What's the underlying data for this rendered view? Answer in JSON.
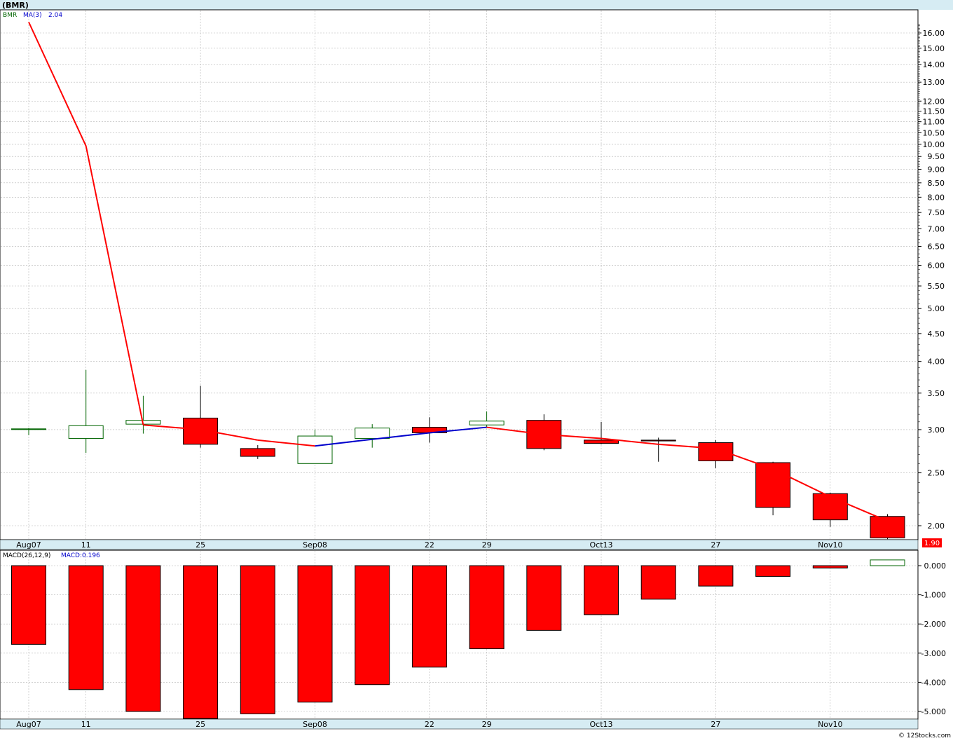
{
  "title": "(BMR)",
  "legend": {
    "symbol": "BMR",
    "ma_label": "MA(3)",
    "ma_value": "2.04"
  },
  "last_price_tag": "1.90",
  "macd_legend": {
    "params": "MACD(26,12,9)",
    "label": "MACD:0.196"
  },
  "watermark": "© 12Stocks.com",
  "x_labels": [
    "Aug07",
    "11",
    "25",
    "Sep08",
    "22",
    "29",
    "Oct13",
    "27",
    "Nov10"
  ],
  "colors": {
    "down": "#ff0000",
    "up_outline": "#006400",
    "ma_down": "#ff0000",
    "ma_up": "#0000cc",
    "axis_bar": "#d6ecf3",
    "grid": "#b4b4b4"
  },
  "chart_data": [
    {
      "type": "candlestick",
      "title": "(BMR)",
      "y_scale": "log",
      "y_ticks": [
        "16.00",
        "15.00",
        "14.00",
        "13.00",
        "12.00",
        "11.50",
        "11.00",
        "10.50",
        "10.00",
        "9.50",
        "9.00",
        "8.50",
        "8.00",
        "7.50",
        "7.00",
        "6.50",
        "6.00",
        "5.50",
        "5.00",
        "4.50",
        "4.00",
        "3.50",
        "3.00",
        "2.50",
        "2.00"
      ],
      "candles": [
        {
          "x": "Aug07",
          "open": 3.01,
          "high": 3.02,
          "low": 2.93,
          "close": 3.01
        },
        {
          "x": "11",
          "open": 2.89,
          "high": 3.86,
          "low": 2.72,
          "close": 3.05
        },
        {
          "x": "",
          "open": 3.07,
          "high": 3.46,
          "low": 2.95,
          "close": 3.12
        },
        {
          "x": "25",
          "open": 3.15,
          "high": 3.61,
          "low": 2.78,
          "close": 2.82
        },
        {
          "x": "",
          "open": 2.77,
          "high": 2.81,
          "low": 2.65,
          "close": 2.68
        },
        {
          "x": "Sep08",
          "open": 2.6,
          "high": 3.0,
          "low": 2.6,
          "close": 2.92
        },
        {
          "x": "",
          "open": 2.89,
          "high": 3.07,
          "low": 2.78,
          "close": 3.02
        },
        {
          "x": "22",
          "open": 3.03,
          "high": 3.16,
          "low": 2.84,
          "close": 2.96
        },
        {
          "x": "29",
          "open": 3.06,
          "high": 3.24,
          "low": 3.03,
          "close": 3.11
        },
        {
          "x": "",
          "open": 3.12,
          "high": 3.2,
          "low": 2.75,
          "close": 2.77
        },
        {
          "x": "Oct13",
          "open": 2.87,
          "high": 3.1,
          "low": 2.82,
          "close": 2.83
        },
        {
          "x": "",
          "open": 2.87,
          "high": 2.9,
          "low": 2.62,
          "close": 2.86
        },
        {
          "x": "27",
          "open": 2.84,
          "high": 2.87,
          "low": 2.55,
          "close": 2.63
        },
        {
          "x": "",
          "open": 2.61,
          "high": 2.62,
          "low": 2.09,
          "close": 2.16
        },
        {
          "x": "Nov10",
          "open": 2.29,
          "high": 2.3,
          "low": 1.99,
          "close": 2.05
        },
        {
          "x": "",
          "open": 2.08,
          "high": 2.1,
          "low": 1.89,
          "close": 1.9
        }
      ],
      "ma3": [
        16.75,
        9.93,
        3.06,
        3.0,
        2.87,
        2.8,
        2.88,
        2.96,
        3.03,
        2.94,
        2.89,
        2.82,
        2.77,
        2.54,
        2.26,
        2.04
      ]
    },
    {
      "type": "bar",
      "title": "MACD(26,12,9)",
      "y_ticks": [
        "0.000",
        "-1.000",
        "-2.000",
        "-3.000",
        "-4.000",
        "-5.000"
      ],
      "ylim": [
        -5.2,
        0.2
      ],
      "values": [
        -2.7,
        -4.25,
        -5.0,
        -5.3,
        -5.08,
        -4.68,
        -4.08,
        -3.48,
        -2.85,
        -2.22,
        -1.68,
        -1.15,
        -0.7,
        -0.37,
        -0.08,
        0.196
      ]
    }
  ]
}
